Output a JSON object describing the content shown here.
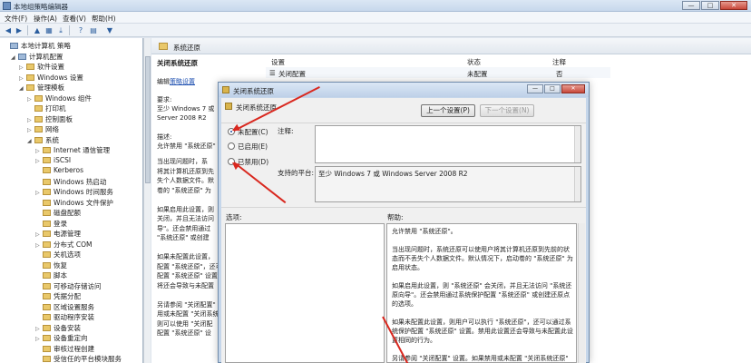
{
  "window": {
    "title": "本地组策略编辑器",
    "min": "—",
    "max": "□",
    "close": "✕"
  },
  "menu": [
    "文件(F)",
    "操作(A)",
    "查看(V)",
    "帮助(H)"
  ],
  "toolbar": {
    "back": "◀",
    "forward": "▶",
    "up": "▲",
    "show": "▦",
    "export": "⤓",
    "help": "?",
    "filter": "▼"
  },
  "tree": [
    {
      "label": "本地计算机 策略",
      "indent": 0,
      "arrow": "",
      "type": "pc"
    },
    {
      "label": "计算机配置",
      "indent": 1,
      "arrow": "◢",
      "type": "pc"
    },
    {
      "label": "软件设置",
      "indent": 2,
      "arrow": "▷",
      "type": "folder"
    },
    {
      "label": "Windows 设置",
      "indent": 2,
      "arrow": "▷",
      "type": "folder"
    },
    {
      "label": "管理模板",
      "indent": 2,
      "arrow": "◢",
      "type": "folder"
    },
    {
      "label": "Windows 组件",
      "indent": 3,
      "arrow": "▷",
      "type": "folder"
    },
    {
      "label": "打印机",
      "indent": 3,
      "arrow": "",
      "type": "folder"
    },
    {
      "label": "控制面板",
      "indent": 3,
      "arrow": "▷",
      "type": "folder"
    },
    {
      "label": "网络",
      "indent": 3,
      "arrow": "▷",
      "type": "folder"
    },
    {
      "label": "系统",
      "indent": 3,
      "arrow": "◢",
      "type": "folder"
    },
    {
      "label": "Internet 通信管理",
      "indent": 4,
      "arrow": "▷",
      "type": "folder"
    },
    {
      "label": "iSCSI",
      "indent": 4,
      "arrow": "▷",
      "type": "folder"
    },
    {
      "label": "Kerberos",
      "indent": 4,
      "arrow": "",
      "type": "folder"
    },
    {
      "label": "Windows 热启动",
      "indent": 4,
      "arrow": "",
      "type": "folder"
    },
    {
      "label": "Windows 时间服务",
      "indent": 4,
      "arrow": "▷",
      "type": "folder"
    },
    {
      "label": "Windows 文件保护",
      "indent": 4,
      "arrow": "",
      "type": "folder"
    },
    {
      "label": "磁盘配额",
      "indent": 4,
      "arrow": "",
      "type": "folder"
    },
    {
      "label": "登录",
      "indent": 4,
      "arrow": "",
      "type": "folder"
    },
    {
      "label": "电源管理",
      "indent": 4,
      "arrow": "▷",
      "type": "folder"
    },
    {
      "label": "分布式 COM",
      "indent": 4,
      "arrow": "▷",
      "type": "folder"
    },
    {
      "label": "关机选项",
      "indent": 4,
      "arrow": "",
      "type": "folder"
    },
    {
      "label": "恢复",
      "indent": 4,
      "arrow": "",
      "type": "folder"
    },
    {
      "label": "脚本",
      "indent": 4,
      "arrow": "",
      "type": "folder"
    },
    {
      "label": "可移动存储访问",
      "indent": 4,
      "arrow": "",
      "type": "folder"
    },
    {
      "label": "凭据分配",
      "indent": 4,
      "arrow": "",
      "type": "folder"
    },
    {
      "label": "区域设置服务",
      "indent": 4,
      "arrow": "",
      "type": "folder"
    },
    {
      "label": "驱动程序安装",
      "indent": 4,
      "arrow": "",
      "type": "folder"
    },
    {
      "label": "设备安装",
      "indent": 4,
      "arrow": "▷",
      "type": "folder"
    },
    {
      "label": "设备重定向",
      "indent": 4,
      "arrow": "▷",
      "type": "folder"
    },
    {
      "label": "审核过程创建",
      "indent": 4,
      "arrow": "",
      "type": "folder"
    },
    {
      "label": "受信任的平台模块服务",
      "indent": 4,
      "arrow": "",
      "type": "folder"
    }
  ],
  "right": {
    "header": "系统还原",
    "desc_title": "关闭系统还原",
    "edit_prefix": "编辑",
    "edit_link": "策略设置",
    "req_label": "要求:",
    "req_line1": "至少 Windows 7 或",
    "req_line2": "Server 2008 R2",
    "desc_label": "描述:",
    "desc_line1": "允许禁用 \"系统还原\"",
    "desc_more": [
      "当出现问题时，系",
      "将其计算机还原到先",
      "失个人数据文件。默",
      "卷的 \"系统还原\" 为",
      "",
      "如果启用此设置，则",
      "关闭，并且无法访问",
      "导\"。还会禁用通过",
      "\"系统还原\" 或创建",
      "",
      "如果未配置此设置，",
      "配置 \"系统还原\"，还可",
      "配置 \"系统还原\" 设置",
      "将还会导致与未配置",
      "",
      "另请参阅 \"关闭配置\"",
      "用或未配置 \"关闭系统",
      "则可以使用 \"关闭配",
      "配置 \"系统还原\" 设"
    ],
    "col_setting": "设置",
    "col_state": "状态",
    "col_note": "注释",
    "row_name": "关闭配置",
    "row_state": "未配置",
    "row_note": "否"
  },
  "dialog": {
    "title": "关闭系统还原",
    "head_title": "关闭系统还原",
    "prev_btn": "上一个设置(P)",
    "next_btn": "下一个设置(N)",
    "radio_notconfigured": "未配置(C)",
    "radio_enabled": "已启用(E)",
    "radio_disabled": "已禁用(D)",
    "selected": "notconfigured",
    "comment_label": "注释:",
    "platform_label": "支持的平台:",
    "platform_value": "至少 Windows 7 或 Windows Server 2008 R2",
    "options_label": "选项:",
    "help_label": "帮助:",
    "help_paragraphs": [
      "允许禁用 \"系统还原\"。",
      "当出现问题时，系统还原可以使用户将其计算机还原到先前的状态而不丢失个人数据文件。默认情况下，启动卷的 \"系统还原\" 为启用状态。",
      "如果启用此设置，则 \"系统还原\" 会关闭，并且无法访问 \"系统还原向导\"。还会禁用通过系统保护配置 \"系统还原\" 或创建还原点的选项。",
      "如果未配置此设置，则用户可以执行 \"系统还原\"，还可以通过系统保护配置 \"系统还原\" 设置。禁用此设置还会导致与未配置此设置相同的行为。",
      "另请参阅 \"关闭配置\" 设置。如果禁用或未配置 \"关闭系统还原\" 设置，则可以使用 \"关闭配置\" 设置来确定配置 \"系统还原\" 的选"
    ]
  },
  "colors": {
    "arrow": "#d9281f",
    "link": "#1d4fb0"
  }
}
